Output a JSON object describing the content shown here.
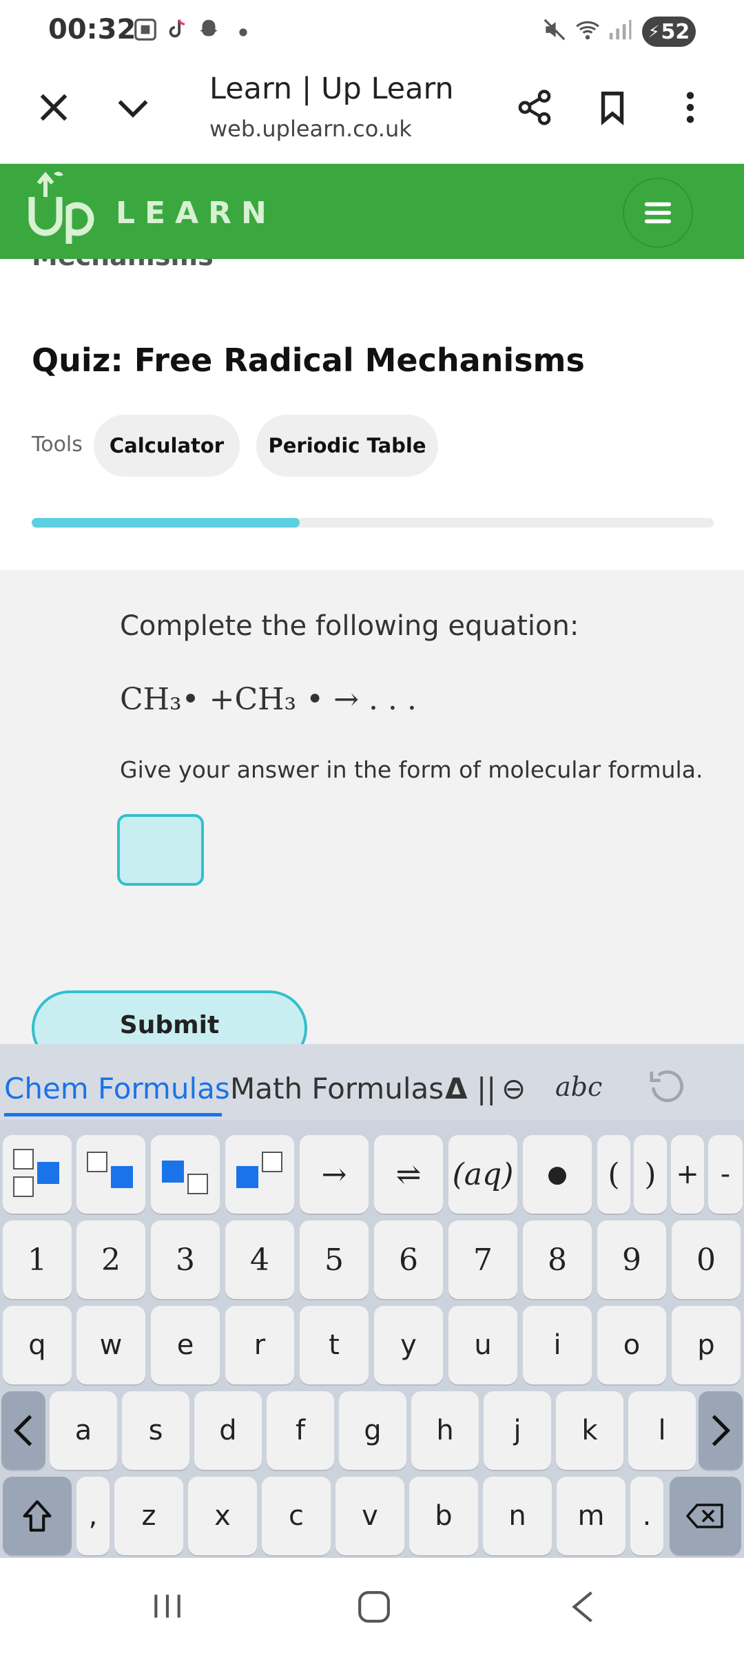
{
  "status_bar": {
    "time": "00:32",
    "battery": "52",
    "icons": [
      "screenshot-icon",
      "tiktok-icon",
      "snapchat-icon",
      "dot-icon",
      "mute-icon",
      "wifi-icon",
      "signal-icon",
      "battery-charging-icon"
    ]
  },
  "browser": {
    "title": "Learn | Up Learn",
    "url": "web.uplearn.co.uk",
    "icons": [
      "close-icon",
      "chevron-down-icon",
      "share-icon",
      "bookmark-icon",
      "more-vertical-icon"
    ]
  },
  "app": {
    "logo_text": "LEARN",
    "brand_color": "#3aa83f"
  },
  "content": {
    "cut_heading": "Mechanisms",
    "quiz_title": "Quiz: Free Radical Mechanisms",
    "tools_label": "Tools",
    "tools": [
      "Calculator",
      "Periodic Table"
    ],
    "progress": 0.393
  },
  "question": {
    "instruction": "Complete the following equation:",
    "equation": "CH₃• +CH₃ • → . . .",
    "hint": "Give your answer in the form of molecular formula.",
    "answer_value": "",
    "submit_label": "Submit"
  },
  "keyboard": {
    "tabs": [
      "Chem Formulas",
      "Math Formulas",
      "Δ",
      "||",
      "⊖",
      "abc"
    ],
    "active_tab": "Chem Formulas",
    "row_symbols": [
      "→",
      "⇌",
      "(aq)",
      "●",
      "(",
      ")",
      "+",
      "-"
    ],
    "row_numbers": [
      "1",
      "2",
      "3",
      "4",
      "5",
      "6",
      "7",
      "8",
      "9",
      "0"
    ],
    "row_q": [
      "q",
      "w",
      "e",
      "r",
      "t",
      "y",
      "u",
      "i",
      "o",
      "p"
    ],
    "row_a": [
      "a",
      "s",
      "d",
      "f",
      "g",
      "h",
      "j",
      "k",
      "l"
    ],
    "row_z": [
      ",",
      "z",
      "x",
      "c",
      "v",
      "b",
      "n",
      "m",
      "."
    ]
  }
}
